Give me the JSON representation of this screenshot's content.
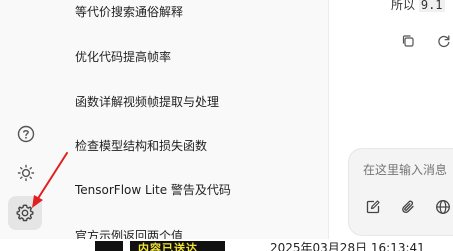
{
  "rail": {
    "icons": [
      "help-icon",
      "theme-icon",
      "settings-icon"
    ]
  },
  "conversations": [
    {
      "title": "等代价搜索通俗解释"
    },
    {
      "title": "优化代码提高帧率"
    },
    {
      "title": "函数详解视频帧提取与处理"
    },
    {
      "title": "检查模型结构和损失函数"
    },
    {
      "title": "TensorFlow Lite 警告及代码"
    },
    {
      "title": "官方示例返回两个值"
    }
  ],
  "chat": {
    "answer_prefix": "所以",
    "answer_code": "9.1",
    "composer_placeholder": "在这里输入消息",
    "message_actions": [
      "copy-icon",
      "regenerate-icon"
    ],
    "composer_actions": [
      "edit-icon",
      "attach-icon",
      "globe-icon"
    ]
  },
  "background_window": {
    "overlay_text": "内容已送达",
    "timestamp": "2025年03月28日 16:13:41"
  },
  "colors": {
    "annotation_arrow": "#e02020",
    "sidebar_bg": "#f9f9f9",
    "composer_bg": "#f4f4f4"
  }
}
